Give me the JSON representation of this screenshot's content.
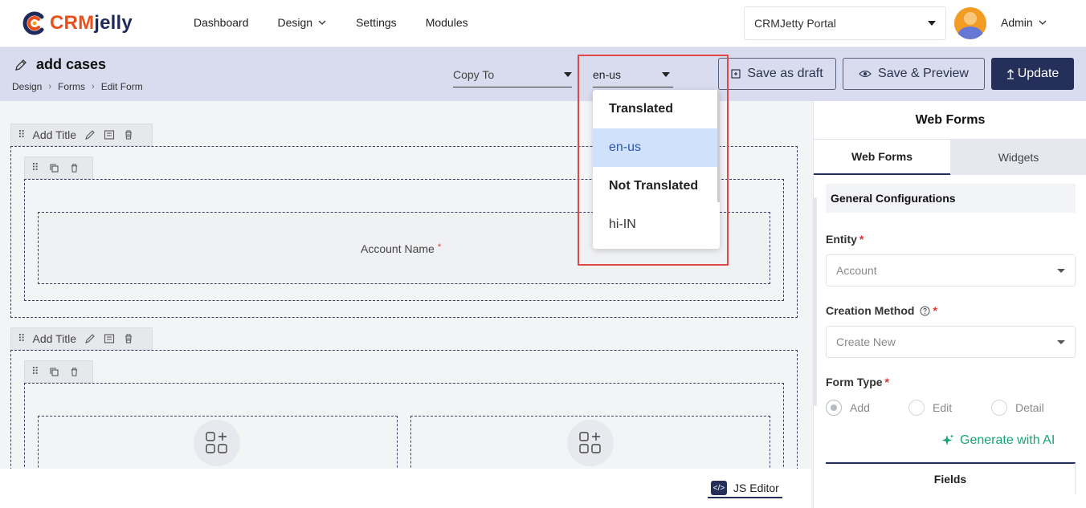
{
  "app": {
    "logo_crm": "CRM",
    "logo_jelly": "jelly"
  },
  "nav": {
    "dashboard": "Dashboard",
    "design": "Design",
    "settings": "Settings",
    "modules": "Modules"
  },
  "portal": {
    "value": "CRMJetty Portal"
  },
  "user": {
    "name": "Admin"
  },
  "page": {
    "title": "add cases",
    "breadcrumb": [
      "Design",
      "Forms",
      "Edit Form"
    ]
  },
  "header_controls": {
    "copy_to": "Copy To",
    "language": "en-us",
    "save_draft": "Save as draft",
    "save_preview": "Save & Preview",
    "update": "Update"
  },
  "language_dropdown": {
    "groups": [
      {
        "label": "Translated",
        "options": [
          "en-us"
        ]
      },
      {
        "label": "Not Translated",
        "options": [
          "hi-IN"
        ]
      }
    ],
    "selected": "en-us"
  },
  "canvas": {
    "sections": [
      {
        "title": "Add Title",
        "fields": [
          {
            "label": "Account Name",
            "required": "*"
          }
        ]
      },
      {
        "title": "Add Title",
        "fields": []
      }
    ],
    "js_editor": "JS Editor"
  },
  "right_panel": {
    "title": "Web Forms",
    "tabs": [
      "Web Forms",
      "Widgets"
    ],
    "active_tab": "Web Forms",
    "section": "General Configurations",
    "entity_label": "Entity",
    "entity_placeholder": "Account",
    "creation_method_label": "Creation Method",
    "creation_method_placeholder": "Create New",
    "form_type_label": "Form Type",
    "form_types": [
      "Add",
      "Edit",
      "Detail"
    ],
    "form_type_selected": "Add",
    "required_mark": "*",
    "generate_ai": "Generate with AI",
    "fields_tab": "Fields"
  },
  "colors": {
    "brand_navy": "#25305a",
    "brand_orange": "#e8501c",
    "header_band": "#d8dcee",
    "ai_green": "#16a572",
    "highlight_red": "#e04848"
  }
}
